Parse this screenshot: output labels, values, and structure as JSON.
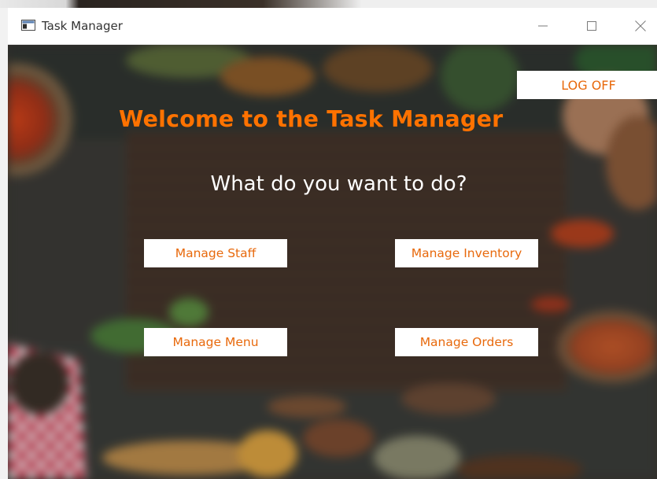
{
  "window": {
    "title": "Task Manager",
    "minimize_glyph": "—",
    "maximize_glyph": "☐",
    "close_glyph": "✕"
  },
  "header": {
    "logoff_label": "LOG OFF",
    "welcome": "Welcome to the Task Manager",
    "question": "What do you want to do?"
  },
  "actions": {
    "staff": "Manage Staff",
    "inventory": "Manage Inventory",
    "menu": "Manage Menu",
    "orders": "Manage Orders"
  },
  "colors": {
    "accent": "#ff7200",
    "button_text": "#e8690c",
    "button_bg": "#ffffff"
  },
  "icons": {
    "app": "window-app-icon",
    "minimize": "minimize-icon",
    "maximize": "maximize-icon",
    "close": "close-icon"
  }
}
